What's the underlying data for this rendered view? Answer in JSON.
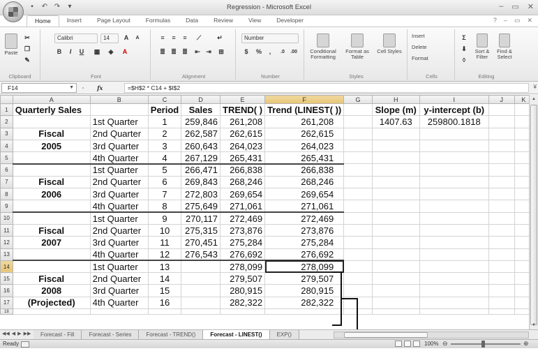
{
  "window": {
    "title": "Regression - Microsoft Excel",
    "controls": [
      "–",
      "▭",
      "✕"
    ]
  },
  "ribbon": {
    "tabs": [
      "Home",
      "Insert",
      "Page Layout",
      "Formulas",
      "Data",
      "Review",
      "View",
      "Developer"
    ],
    "active_tab": "Home",
    "groups": {
      "clipboard": {
        "label": "Clipboard",
        "paste": "Paste"
      },
      "font": {
        "label": "Font",
        "font_name": "Calibri",
        "font_size": "14",
        "bold": "B",
        "italic": "I",
        "underline": "U"
      },
      "alignment": {
        "label": "Alignment"
      },
      "number": {
        "label": "Number",
        "format": "Number",
        "currency": "$",
        "percent": "%",
        "comma": ","
      },
      "styles": {
        "label": "Styles",
        "conditional": "Conditional Formatting",
        "format_table": "Format as Table",
        "cell_styles": "Cell Styles"
      },
      "cells": {
        "label": "Cells",
        "insert": "Insert",
        "delete": "Delete",
        "format": "Format"
      },
      "editing": {
        "label": "Editing",
        "sort": "Sort & Filter",
        "find": "Find & Select"
      }
    }
  },
  "formula_bar": {
    "name_box": "F14",
    "fx": "fx",
    "formula": "=$H$2 * C14 + $I$2"
  },
  "columns": [
    "A",
    "B",
    "C",
    "D",
    "E",
    "F",
    "G",
    "H",
    "I",
    "J",
    "K"
  ],
  "rows": [
    {
      "n": "1",
      "A": "Quarterly Sales",
      "B": "",
      "C": "Period",
      "D": "Sales",
      "E": "TREND( )",
      "F": "Trend (LINEST( ))",
      "G": "",
      "H": "Slope (m)",
      "I": "y-intercept (b)"
    },
    {
      "n": "2",
      "A": "",
      "B": "1st Quarter",
      "C": "1",
      "D": "259,846",
      "E": "261,208",
      "F": "261,208",
      "G": "",
      "H": "1407.63",
      "I": "259800.1818"
    },
    {
      "n": "3",
      "A": "Fiscal",
      "B": "2nd Quarter",
      "C": "2",
      "D": "262,587",
      "E": "262,615",
      "F": "262,615",
      "G": "",
      "H": "",
      "I": ""
    },
    {
      "n": "4",
      "A": "2005",
      "B": "3rd Quarter",
      "C": "3",
      "D": "260,643",
      "E": "264,023",
      "F": "264,023",
      "G": "",
      "H": "",
      "I": ""
    },
    {
      "n": "5",
      "A": "",
      "B": "4th Quarter",
      "C": "4",
      "D": "267,129",
      "E": "265,431",
      "F": "265,431",
      "G": "",
      "H": "",
      "I": ""
    },
    {
      "n": "6",
      "A": "",
      "B": "1st Quarter",
      "C": "5",
      "D": "266,471",
      "E": "266,838",
      "F": "266,838",
      "G": "",
      "H": "",
      "I": ""
    },
    {
      "n": "7",
      "A": "Fiscal",
      "B": "2nd Quarter",
      "C": "6",
      "D": "269,843",
      "E": "268,246",
      "F": "268,246",
      "G": "",
      "H": "",
      "I": ""
    },
    {
      "n": "8",
      "A": "2006",
      "B": "3rd Quarter",
      "C": "7",
      "D": "272,803",
      "E": "269,654",
      "F": "269,654",
      "G": "",
      "H": "",
      "I": ""
    },
    {
      "n": "9",
      "A": "",
      "B": "4th Quarter",
      "C": "8",
      "D": "275,649",
      "E": "271,061",
      "F": "271,061",
      "G": "",
      "H": "",
      "I": ""
    },
    {
      "n": "10",
      "A": "",
      "B": "1st Quarter",
      "C": "9",
      "D": "270,117",
      "E": "272,469",
      "F": "272,469",
      "G": "",
      "H": "",
      "I": ""
    },
    {
      "n": "11",
      "A": "Fiscal",
      "B": "2nd Quarter",
      "C": "10",
      "D": "275,315",
      "E": "273,876",
      "F": "273,876",
      "G": "",
      "H": "",
      "I": ""
    },
    {
      "n": "12",
      "A": "2007",
      "B": "3rd Quarter",
      "C": "11",
      "D": "270,451",
      "E": "275,284",
      "F": "275,284",
      "G": "",
      "H": "",
      "I": ""
    },
    {
      "n": "13",
      "A": "",
      "B": "4th Quarter",
      "C": "12",
      "D": "276,543",
      "E": "276,692",
      "F": "276,692",
      "G": "",
      "H": "",
      "I": ""
    },
    {
      "n": "14",
      "A": "",
      "B": "1st Quarter",
      "C": "13",
      "D": "",
      "E": "278,099",
      "F": "278,099",
      "G": "",
      "H": "",
      "I": ""
    },
    {
      "n": "15",
      "A": "Fiscal",
      "B": "2nd Quarter",
      "C": "14",
      "D": "",
      "E": "279,507",
      "F": "279,507",
      "G": "",
      "H": "",
      "I": ""
    },
    {
      "n": "16",
      "A": "2008",
      "B": "3rd Quarter",
      "C": "15",
      "D": "",
      "E": "280,915",
      "F": "280,915",
      "G": "",
      "H": "",
      "I": ""
    },
    {
      "n": "17",
      "A": "(Projected)",
      "B": "4th Quarter",
      "C": "16",
      "D": "",
      "E": "282,322",
      "F": "282,322",
      "G": "",
      "H": "",
      "I": ""
    },
    {
      "n": "18",
      "A": "",
      "B": "",
      "C": "",
      "D": "",
      "E": "",
      "F": "",
      "G": "",
      "H": "",
      "I": ""
    }
  ],
  "sheet_tabs": [
    "Forecast - Fill",
    "Forecast - Series",
    "Forecast - TREND()",
    "Forecast - LINEST()",
    "EXP()"
  ],
  "active_sheet": "Forecast - LINEST()",
  "status": {
    "ready": "Ready",
    "zoom": "100%"
  },
  "selected_cell": "F14"
}
